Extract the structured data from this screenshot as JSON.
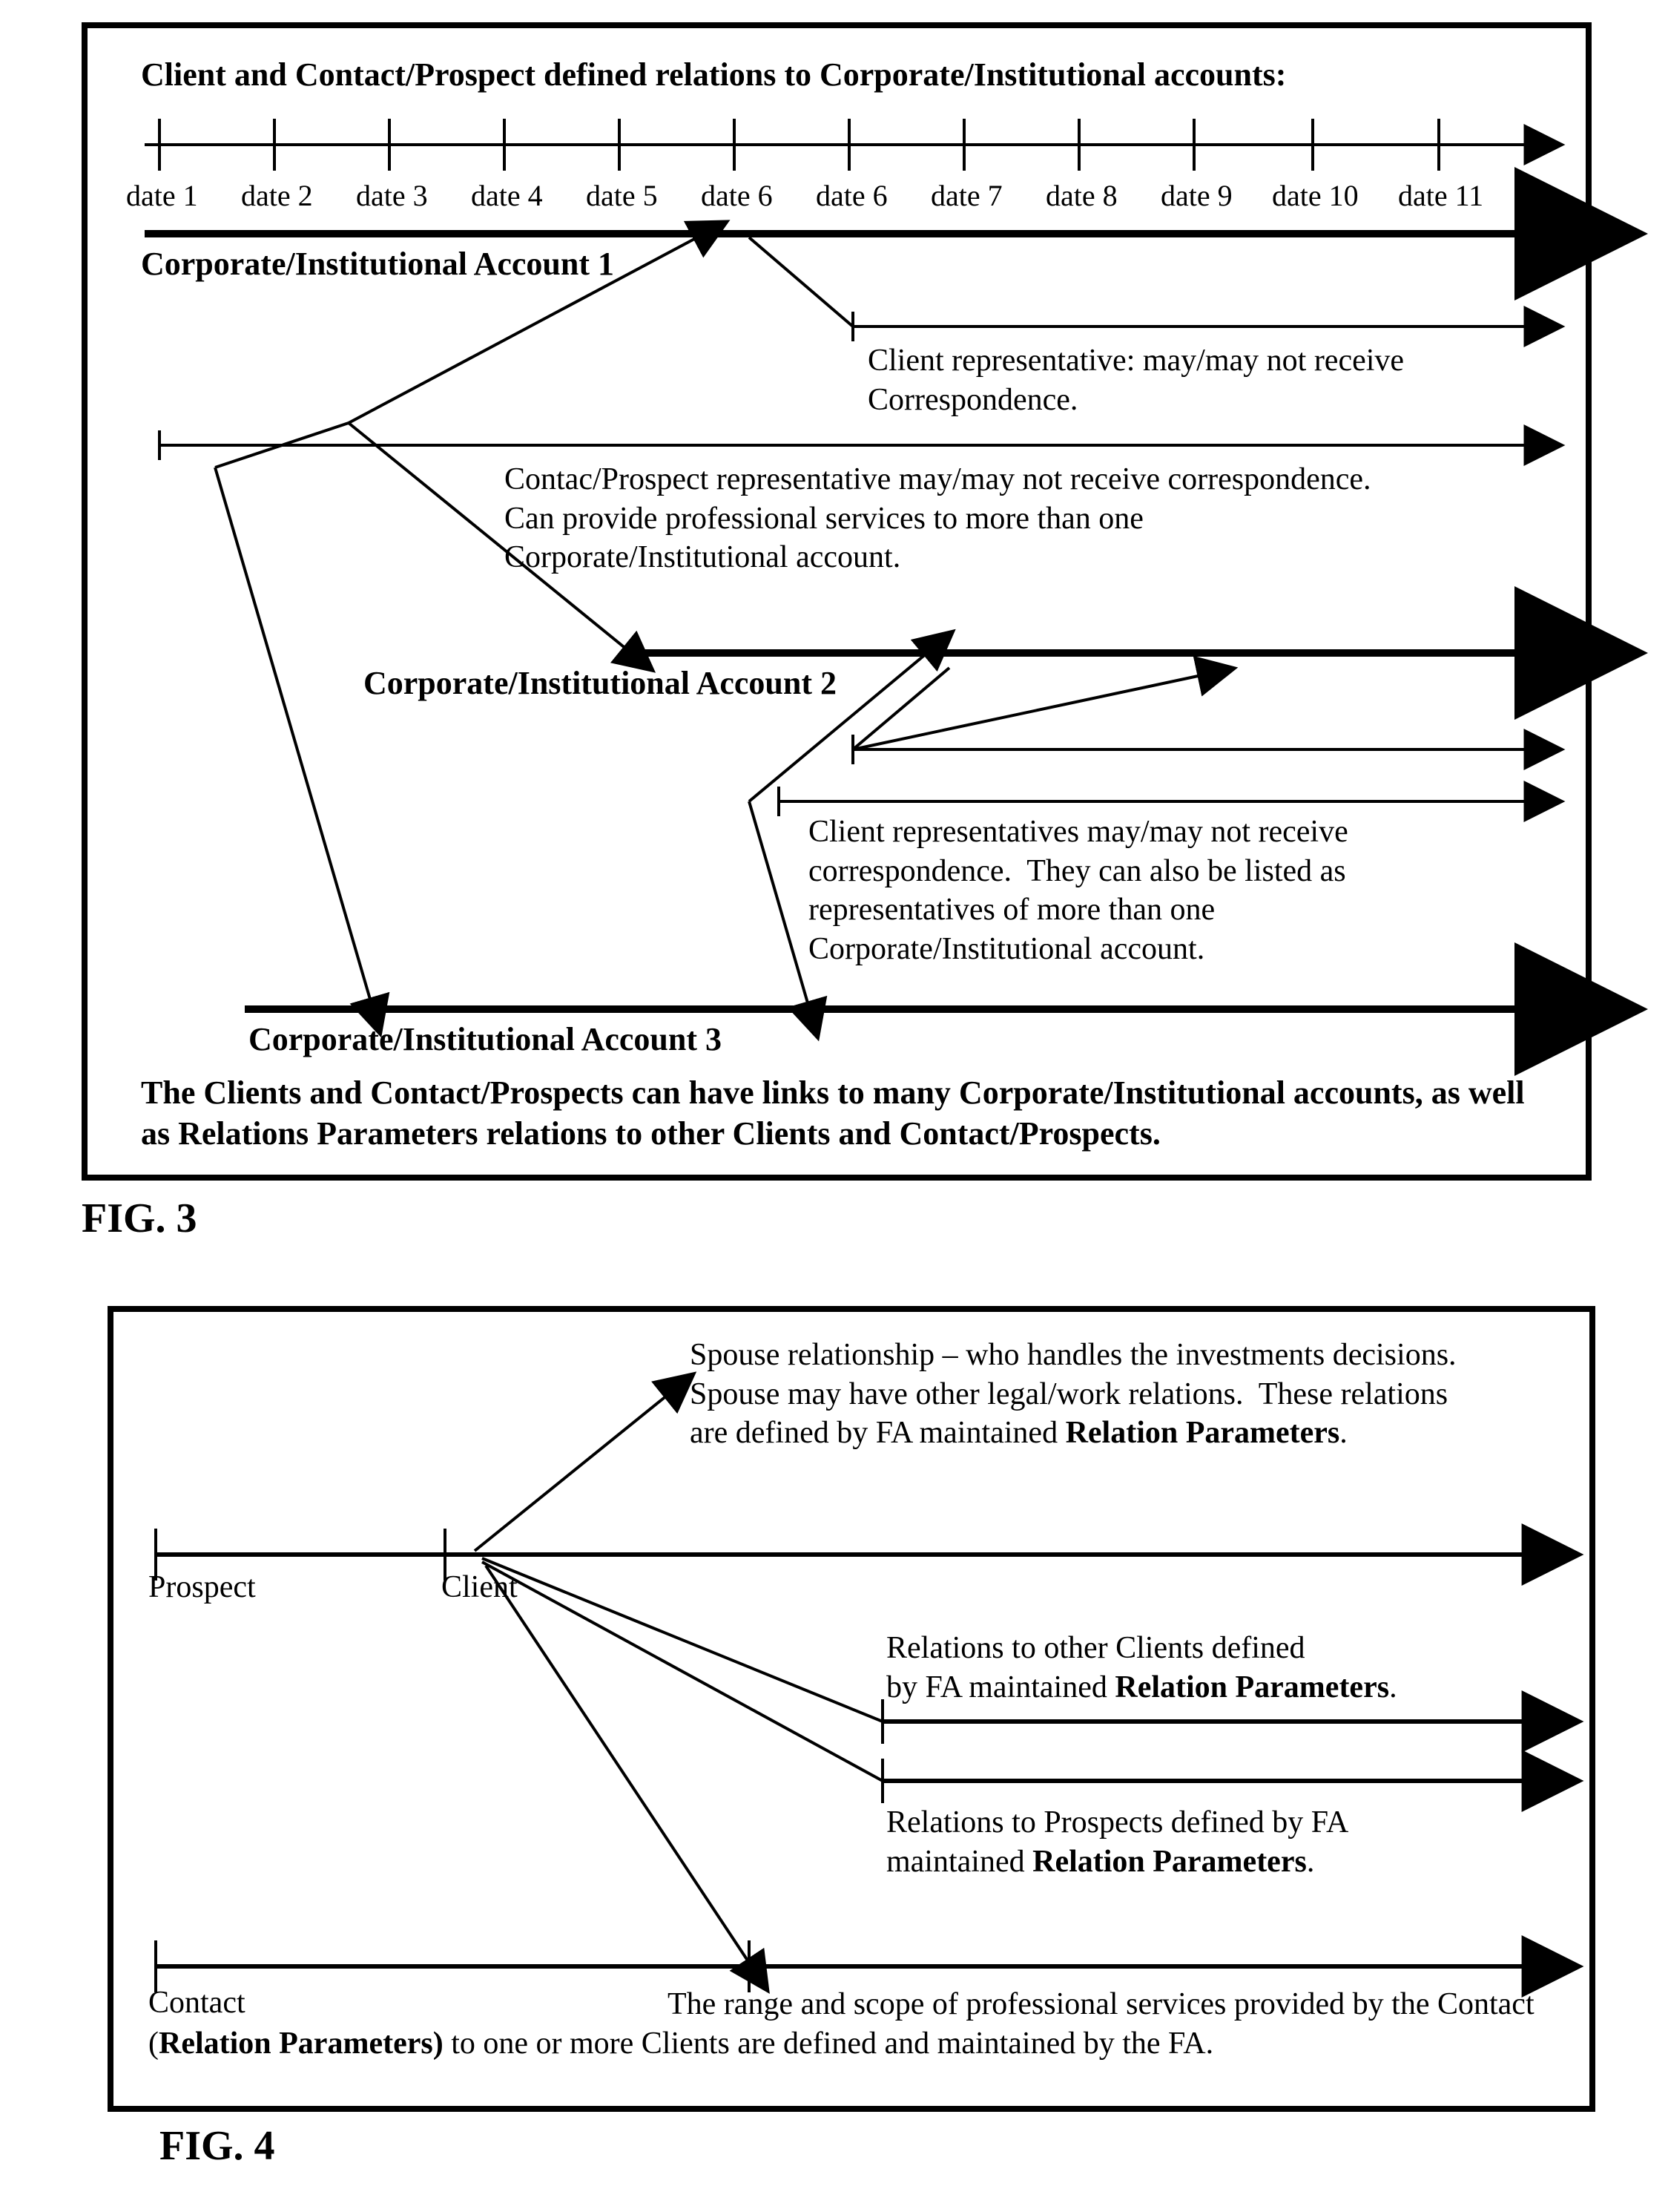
{
  "fig3": {
    "title": "Client and Contact/Prospect defined relations to Corporate/Institutional accounts:",
    "dates": [
      "date 1",
      "date 2",
      "date 3",
      "date 4",
      "date 5",
      "date 6",
      "date 6",
      "date 7",
      "date 8",
      "date 9",
      "date 10",
      "date 11"
    ],
    "acct1": "Corporate/Institutional Account 1",
    "acct2": "Corporate/Institutional Account 2",
    "acct3": "Corporate/Institutional Account 3",
    "note1": "Client representative: may/may not receive\nCorrespondence.",
    "note2": "Contac/Prospect representative may/may not receive correspondence.\nCan provide professional services to more than one\nCorporate/Institutional account.",
    "note3": "Client representatives may/may not receive\ncorrespondence.  They can also be listed as\nrepresentatives of more than one\nCorporate/Institutional account.",
    "footer": "The Clients and Contact/Prospects can have links to many Corporate/Institutional accounts, as well as Relations Parameters relations to other Clients and Contact/Prospects.",
    "caption": "FIG. 3"
  },
  "fig4": {
    "spouseNote": "Spouse relationship – who handles the investments decisions.\nSpouse may have other legal/work relations.  These relations\nare defined by FA maintained ",
    "spouseBold": "Relation Parameters",
    "spouseTail": ".",
    "clientsNote": "Relations to other Clients defined\nby FA maintained ",
    "clientsBold": "Relation Parameters",
    "clientsTail": ".",
    "prospectsNote": "Relations to Prospects defined by FA\nmaintained ",
    "prospectsBold": "Relation Parameters",
    "prospectsTail": ".",
    "prospectLabel": "Prospect",
    "clientLabel": "Client",
    "contactLabel": "Contact",
    "contactNote1": "The range and scope of professional services provided by the Contact (",
    "contactBold": "Relation Parameters)",
    "contactNote2": " to one or more Clients are defined and maintained by the FA.",
    "caption": "FIG. 4"
  }
}
